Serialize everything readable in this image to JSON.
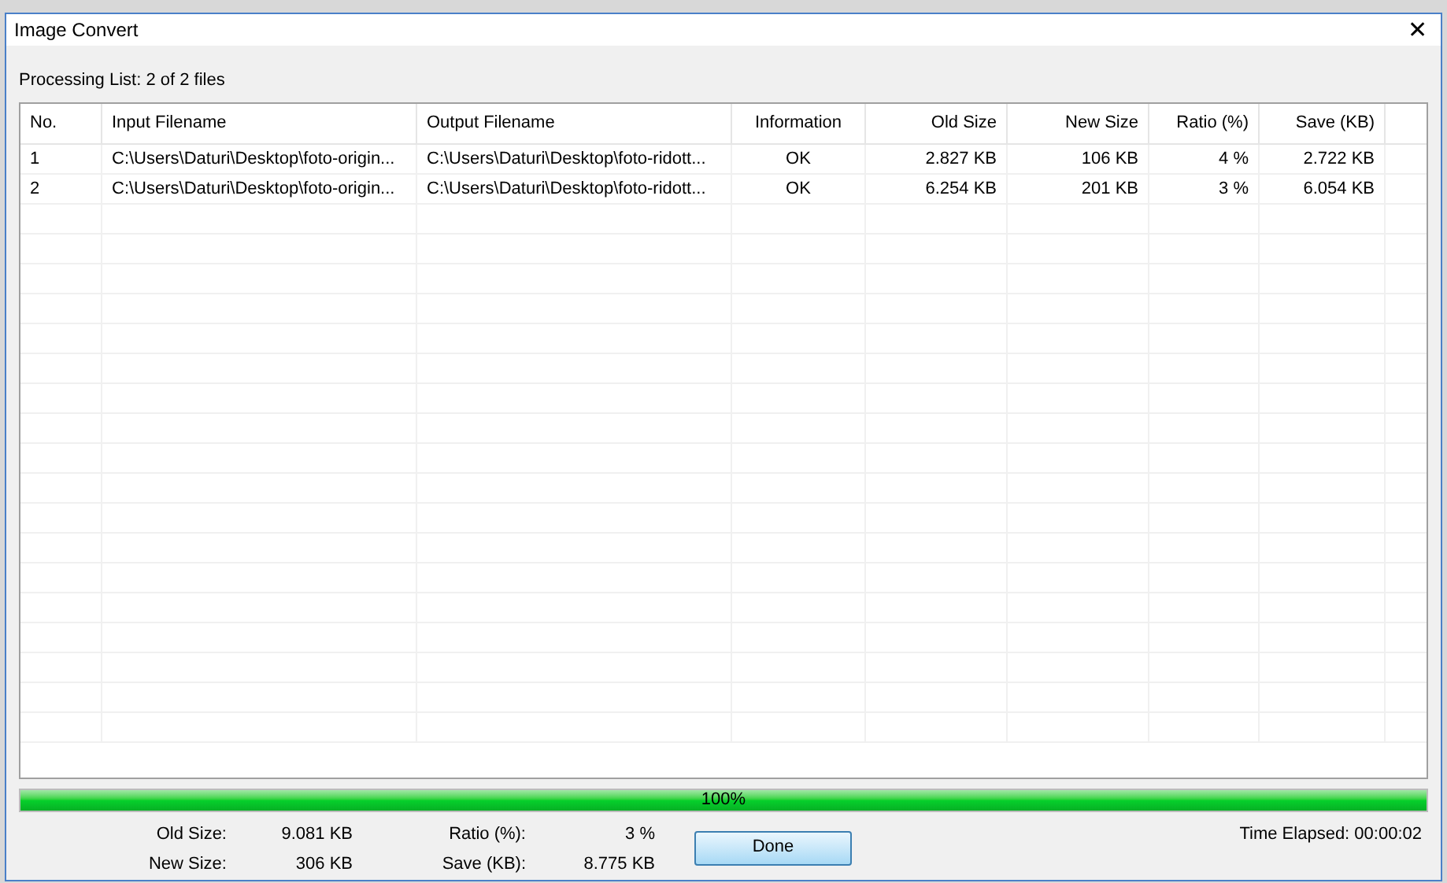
{
  "window": {
    "title": "Image Convert",
    "close": "✕"
  },
  "processing_label": "Processing List: 2 of 2 files",
  "table": {
    "columns": [
      {
        "label": "No."
      },
      {
        "label": "Input Filename"
      },
      {
        "label": "Output Filename"
      },
      {
        "label": "Information"
      },
      {
        "label": "Old Size"
      },
      {
        "label": "New Size"
      },
      {
        "label": "Ratio (%)"
      },
      {
        "label": "Save (KB)"
      }
    ],
    "rows": [
      [
        "1",
        "C:\\Users\\Daturi\\Desktop\\foto-origin...",
        "C:\\Users\\Daturi\\Desktop\\foto-ridott...",
        "OK",
        "2.827 KB",
        "106 KB",
        "4 %",
        "2.722 KB"
      ],
      [
        "2",
        "C:\\Users\\Daturi\\Desktop\\foto-origin...",
        "C:\\Users\\Daturi\\Desktop\\foto-ridott...",
        "OK",
        "6.254 KB",
        "201 KB",
        "3 %",
        "6.054 KB"
      ]
    ]
  },
  "progress": {
    "level": 1,
    "label": "100%"
  },
  "summary": [
    {
      "label": "Old Size:",
      "value": "9.081 KB"
    },
    {
      "label": "New Size:",
      "value": "306 KB"
    },
    {
      "label": "Ratio (%):",
      "value": "3 %"
    },
    {
      "label": "Save (KB):",
      "value": "8.775 KB"
    }
  ],
  "done_button": "Done",
  "time_elapsed": "Time Elapsed: 00:00:02"
}
